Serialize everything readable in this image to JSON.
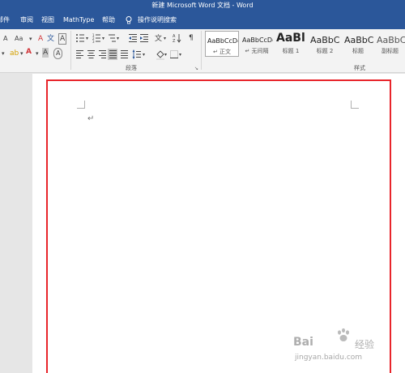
{
  "window": {
    "title": "新建 Microsoft Word 文档 - Word"
  },
  "menu": {
    "tabs": [
      "邮件",
      "审阅",
      "视图",
      "MathType",
      "帮助"
    ],
    "tell_me": "操作说明搜索"
  },
  "ribbon": {
    "font_buttons": [
      "A",
      "Aa",
      "A",
      "A",
      "A",
      "A"
    ],
    "paragraph_group": "段落",
    "styles_group": "样式",
    "styles": [
      {
        "sample": "AaBbCcDc",
        "name": "正文",
        "selected": true
      },
      {
        "sample": "AaBbCcDc",
        "name": "无间隔"
      },
      {
        "sample": "AaBl",
        "name": "标题 1"
      },
      {
        "sample": "AaBbC",
        "name": "标题 2"
      },
      {
        "sample": "AaBbC",
        "name": "标题"
      },
      {
        "sample": "AaBbC",
        "name": "副标题"
      }
    ]
  },
  "document": {
    "paragraph_mark": "↵"
  },
  "watermark": {
    "brand": "Bai",
    "brand2": "经验",
    "url": "jingyan.baidu.com"
  },
  "colors": {
    "title_bar": "#2b579a",
    "ribbon": "#f3f3f3",
    "highlight_box": "#e8252b"
  }
}
